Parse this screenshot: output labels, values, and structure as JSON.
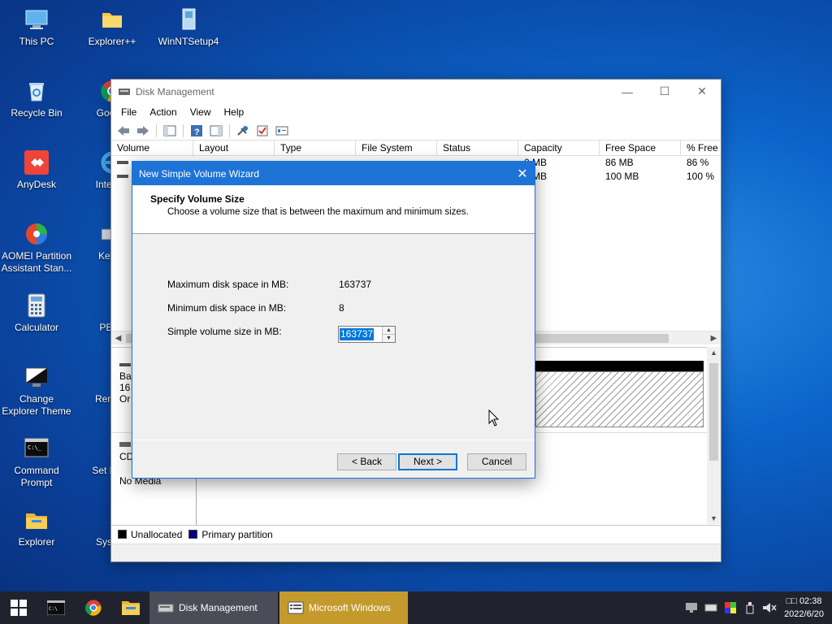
{
  "desktop": {
    "icons": [
      {
        "label": "This PC",
        "icon": "computer-icon"
      },
      {
        "label": "Explorer++",
        "icon": "folder-icon"
      },
      {
        "label": "WinNTSetup4",
        "icon": "setup-icon"
      },
      {
        "label": "Recycle Bin",
        "icon": "recycle-bin-icon"
      },
      {
        "label": "Google",
        "icon": "chrome-icon"
      },
      {
        "label": "AnyDesk",
        "icon": "anydesk-icon"
      },
      {
        "label": "Internet",
        "icon": "internet-explorer-icon"
      },
      {
        "label": "AOMEI Partition Assistant Stan...",
        "icon": "aomei-icon"
      },
      {
        "label": "Keybo",
        "icon": "keyboard-icon"
      },
      {
        "label": "Calculator",
        "icon": "calculator-icon"
      },
      {
        "label": "PENe",
        "icon": "penetwork-icon"
      },
      {
        "label": "Change Explorer Theme",
        "icon": "theme-icon"
      },
      {
        "label": "Remote",
        "icon": "remote-icon"
      },
      {
        "label": "Command Prompt",
        "icon": "cmd-icon"
      },
      {
        "label": "Set Reso",
        "icon": "resolution-icon"
      },
      {
        "label": "Explorer",
        "icon": "explorer-icon"
      },
      {
        "label": "System",
        "icon": "system-icon"
      }
    ]
  },
  "disk_management": {
    "title": "Disk Management",
    "menu": [
      "File",
      "Action",
      "View",
      "Help"
    ],
    "columns": [
      "Volume",
      "Layout",
      "Type",
      "File System",
      "Status",
      "Capacity",
      "Free Space",
      "% Free"
    ],
    "rows": [
      {
        "volume": "",
        "capacity": "0 MB",
        "free": "86 MB",
        "pct": "86 %"
      },
      {
        "volume": "(",
        "capacity": "0 MB",
        "free": "100 MB",
        "pct": "100 %"
      }
    ],
    "disk0_label": "Ba",
    "disk0_size": "16",
    "disk0_status": "Or",
    "cd_label": "CD",
    "cd_status": "No Media",
    "legend": [
      {
        "label": "Unallocated",
        "color": "#000000"
      },
      {
        "label": "Primary partition",
        "color": "#000080"
      }
    ]
  },
  "wizard": {
    "title": "New Simple Volume Wizard",
    "heading": "Specify Volume Size",
    "subheading": "Choose a volume size that is between the maximum and minimum sizes.",
    "max_label": "Maximum disk space in MB:",
    "max_value": "163737",
    "min_label": "Minimum disk space in MB:",
    "min_value": "8",
    "size_label": "Simple volume size in MB:",
    "size_value": "163737",
    "back_label": "< Back",
    "next_label": "Next >",
    "cancel_label": "Cancel"
  },
  "taskbar": {
    "tasks": [
      {
        "label": "Disk Management",
        "active": true
      },
      {
        "label": "Microsoft Windows",
        "active": false
      }
    ],
    "clock_time": "□□ 02:38",
    "clock_date": "2022/6/20"
  }
}
